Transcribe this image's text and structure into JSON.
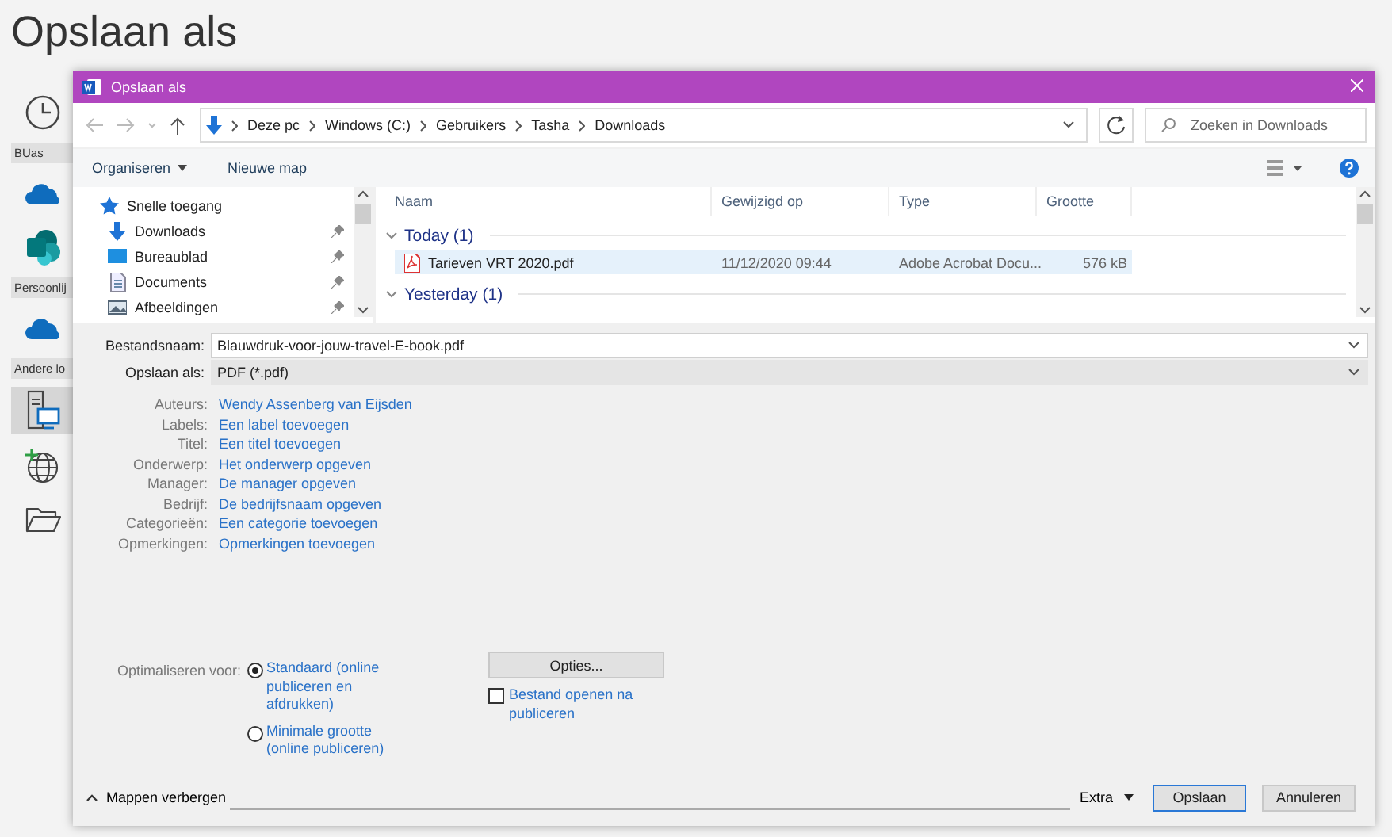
{
  "backstage": {
    "title": "Opslaan als",
    "items": [
      {
        "kind": "recent"
      },
      {
        "kind": "header",
        "label": "BUas"
      },
      {
        "kind": "onedrive"
      },
      {
        "kind": "sharepoint"
      },
      {
        "kind": "header",
        "label": "Persoonlij"
      },
      {
        "kind": "onedrive"
      },
      {
        "kind": "header",
        "label": "Andere lo"
      },
      {
        "kind": "computer",
        "selected": true
      },
      {
        "kind": "globe",
        "selected": false
      },
      {
        "kind": "folder",
        "selected": false
      }
    ]
  },
  "dialog": {
    "title": "Opslaan als",
    "address": {
      "path": [
        "Deze pc",
        "Windows (C:)",
        "Gebruikers",
        "Tasha",
        "Downloads"
      ]
    },
    "search": {
      "placeholder": "Zoeken in Downloads"
    },
    "toolbar": {
      "organize": "Organiseren",
      "new_folder": "Nieuwe map"
    },
    "nav": [
      {
        "kind": "star",
        "label": "Snelle toegang",
        "pinned": false
      },
      {
        "kind": "download",
        "label": "Downloads",
        "pinned": true
      },
      {
        "kind": "desktop",
        "label": "Bureaublad",
        "pinned": true
      },
      {
        "kind": "documents",
        "label": "Documents",
        "pinned": true
      },
      {
        "kind": "pictures",
        "label": "Afbeeldingen",
        "pinned": true
      }
    ],
    "columns": [
      "Naam",
      "Gewijzigd op",
      "Type",
      "Grootte"
    ],
    "groups": [
      {
        "label": "Today (1)",
        "expanded": true,
        "files": [
          {
            "name": "Tarieven VRT 2020.pdf",
            "modified": "11/12/2020 09:44",
            "type": "Adobe Acrobat Docu...",
            "size": "576 kB",
            "selected": true
          }
        ]
      },
      {
        "label": "Yesterday (1)",
        "expanded": true
      }
    ],
    "filename": {
      "label": "Bestandsnaam:",
      "value": "Blauwdruk-voor-jouw-travel-E-book.pdf"
    },
    "save_type": {
      "label": "Opslaan als:",
      "value": "PDF (*.pdf)"
    },
    "metadata": [
      {
        "label": "Auteurs:",
        "value": "Wendy Assenberg van Eijsden"
      },
      {
        "label": "Labels:",
        "value": "Een label toevoegen"
      },
      {
        "label": "Titel:",
        "value": "Een titel toevoegen"
      },
      {
        "label": "Onderwerp:",
        "value": "Het onderwerp opgeven"
      },
      {
        "label": "Manager:",
        "value": "De manager opgeven"
      },
      {
        "label": "Bedrijf:",
        "value": "De bedrijfsnaam opgeven"
      },
      {
        "label": "Categorieën:",
        "value": "Een categorie toevoegen"
      },
      {
        "label": "Opmerkingen:",
        "value": "Opmerkingen toevoegen"
      }
    ],
    "optimize": {
      "label": "Optimaliseren voor:",
      "options": [
        {
          "label": "Standaard (online publiceren en afdrukken)",
          "selected": true
        },
        {
          "label": "Minimale grootte (online publiceren)",
          "selected": false
        }
      ]
    },
    "options_button": "Opties...",
    "open_after": {
      "label": "Bestand openen na publiceren",
      "checked": false
    },
    "hide_folders": "Mappen verbergen",
    "extra": "Extra",
    "save": "Opslaan",
    "cancel": "Annuleren"
  }
}
